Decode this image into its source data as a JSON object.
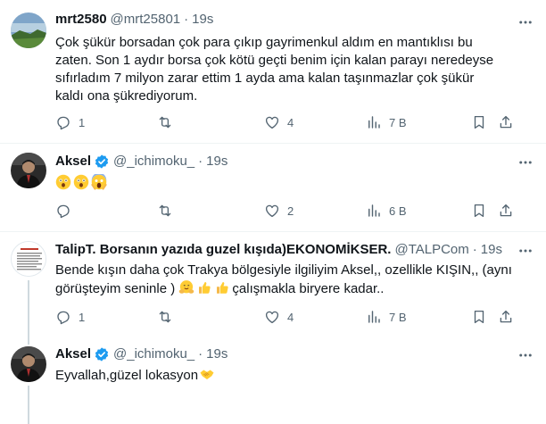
{
  "tweets": [
    {
      "name": "mrt2580",
      "handle": "@mrt25801",
      "sep": "·",
      "time": "19s",
      "text": "Çok şükür borsadan çok para çıkıp gayrimenkul aldım en mantıklısı bu zaten. Son 1 aydır borsa çok kötü geçti benim için kalan parayı neredeyse sıfırladım 7 milyon zarar ettim 1 ayda ama kalan taşınmazlar çok şükür kaldı ona şükrediyorum.",
      "replies": "1",
      "retweets": "",
      "likes": "4",
      "views": "7 B"
    },
    {
      "name": "Aksel",
      "handle": "@_ichimoku_",
      "sep": "·",
      "time": "19s",
      "emojis": [
        "astonished-face",
        "astonished-face",
        "screaming-face"
      ],
      "replies": "",
      "retweets": "",
      "likes": "2",
      "views": "6 B"
    },
    {
      "name": "TalipT. Borsanın yazıda guzel kışıda)EKONOMİKSER.",
      "handle": "@TALPCom",
      "sep": "·",
      "time": "19s",
      "text_a": "Bende kışın daha çok Trakya bölgesiyle ilgiliyim Aksel,, ozellikle KIŞIN,, (aynı görüşteyim seninle )",
      "text_b": "çalışmakla biryere kadar..",
      "emojis": [
        "hugging-face",
        "thumbs-up",
        "thumbs-up"
      ],
      "replies": "1",
      "retweets": "",
      "likes": "4",
      "views": "7 B"
    },
    {
      "name": "Aksel",
      "handle": "@_ichimoku_",
      "sep": "·",
      "time": "19s",
      "text": "Eyvallah,güzel lokasyon",
      "emojis": [
        "handshake"
      ]
    }
  ],
  "colors": {
    "text": "#0f1419",
    "muted": "#536471",
    "verified": "#1d9bf0",
    "divider": "#eff3f4",
    "thread": "#cfd9de"
  }
}
